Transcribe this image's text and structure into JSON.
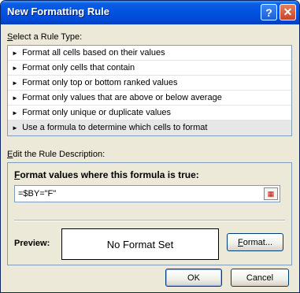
{
  "window": {
    "title": "New Formatting Rule",
    "help_glyph": "?",
    "close_glyph": "✕"
  },
  "select_label": "elect a Rule Type:",
  "select_label_accel": "S",
  "rule_types": [
    "Format all cells based on their values",
    "Format only cells that contain",
    "Format only top or bottom ranked values",
    "Format only values that are above or below average",
    "Format only unique or duplicate values",
    "Use a formula to determine which cells to format"
  ],
  "rule_arrow": "►",
  "edit_label": "dit the Rule Description:",
  "edit_label_accel": "E",
  "formula_heading": "ormat values where this formula is true:",
  "formula_heading_accel": "F",
  "formula_value": "=$BY=\"F\"",
  "preview_label": "Preview:",
  "preview_text": "No Format Set",
  "format_button": "ormat...",
  "format_button_accel": "F",
  "ok_button": "OK",
  "cancel_button": "Cancel"
}
